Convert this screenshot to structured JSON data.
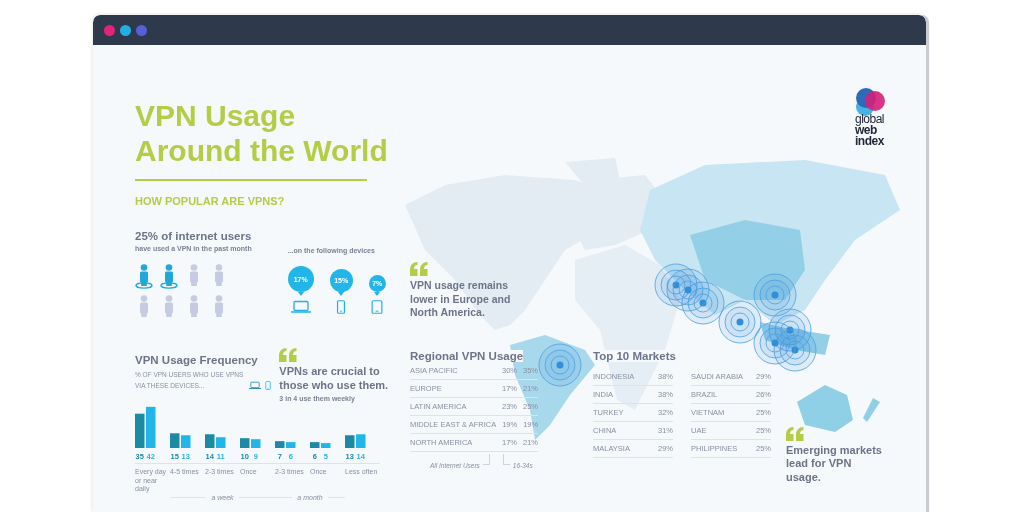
{
  "title_lines": [
    "VPN Usage",
    "Around the World"
  ],
  "section_heading": "HOW POPULAR ARE VPNS?",
  "internet_users": {
    "headline": "25% of internet users",
    "subtext": "have used a VPN in the past month",
    "people": [
      {
        "highlighted": true
      },
      {
        "highlighted": true
      },
      {
        "highlighted": false
      },
      {
        "highlighted": false
      },
      {
        "highlighted": false
      },
      {
        "highlighted": false
      },
      {
        "highlighted": false
      },
      {
        "highlighted": false
      }
    ]
  },
  "devices": {
    "caption": "...on the following devices",
    "items": [
      {
        "kind": "laptop",
        "share": "17%"
      },
      {
        "kind": "phone",
        "share": "15%"
      },
      {
        "kind": "tablet",
        "share": "7%"
      }
    ]
  },
  "frequency": {
    "title": "VPN Usage Frequency",
    "subtitle_lines": [
      "% OF VPN USERS WHO USE VPNS",
      "VIA THESE DEVICES..."
    ],
    "legend": [
      {
        "kind": "laptop"
      },
      {
        "kind": "phone"
      }
    ],
    "chart_data": {
      "type": "bar",
      "categories": [
        "Every day or near daily",
        "4-5 times",
        "2-3 times",
        "Once",
        "2-3 times",
        "Once",
        "Less often"
      ],
      "series": [
        {
          "color": "#1d8aa5",
          "values": [
            35,
            15,
            14,
            10,
            7,
            6,
            13
          ]
        },
        {
          "color": "#22b5e8",
          "values": [
            42,
            13,
            11,
            9,
            6,
            5,
            14
          ]
        }
      ],
      "data_labels": true
    },
    "groups": [
      "a week",
      "a month"
    ]
  },
  "quote_crucial": {
    "text": "VPNs are crucial to those who use them.",
    "subtext": "3 in 4 use them weekly"
  },
  "logo": {
    "lines": [
      "global",
      "web",
      "index"
    ]
  },
  "quote_europe": {
    "text": "VPN usage remains lower in Europe and North America."
  },
  "regional": {
    "title": "Regional VPN Usage",
    "rows": [
      {
        "region": "ASIA PACIFIC",
        "all_users": "30%",
        "age_16_34": "35%"
      },
      {
        "region": "EUROPE",
        "all_users": "17%",
        "age_16_34": "21%"
      },
      {
        "region": "LATIN AMERICA",
        "all_users": "23%",
        "age_16_34": "25%"
      },
      {
        "region": "MIDDLE EAST & AFRICA",
        "all_users": "19%",
        "age_16_34": "19%"
      },
      {
        "region": "NORTH AMERICA",
        "all_users": "17%",
        "age_16_34": "21%"
      }
    ],
    "footnotes": [
      "All Internet Users",
      "16-34s"
    ]
  },
  "top_markets": {
    "title": "Top 10 Markets",
    "columns": [
      [
        {
          "country": "INDONESIA",
          "share": "38%"
        },
        {
          "country": "INDIA",
          "share": "38%"
        },
        {
          "country": "TURKEY",
          "share": "32%"
        },
        {
          "country": "CHINA",
          "share": "31%"
        },
        {
          "country": "MALAYSIA",
          "share": "29%"
        }
      ],
      [
        {
          "country": "SAUDI ARABIA",
          "share": "29%"
        },
        {
          "country": "BRAZIL",
          "share": "26%"
        },
        {
          "country": "VIETNAM",
          "share": "25%"
        },
        {
          "country": "UAE",
          "share": "25%"
        },
        {
          "country": "PHILIPPINES",
          "share": "25%"
        }
      ]
    ]
  },
  "quote_emerging": {
    "text": "Emerging markets lead for VPN usage."
  }
}
